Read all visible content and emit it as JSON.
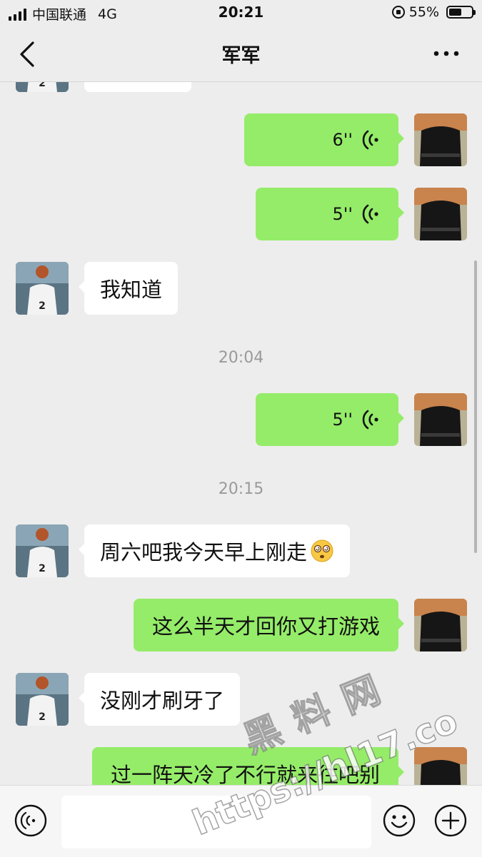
{
  "status_bar": {
    "carrier": "中国联通",
    "network": "4G",
    "time": "20:21",
    "battery_percent": "55%",
    "battery_level": 0.55
  },
  "header": {
    "title": "军军",
    "back_icon": "chevron-left-icon",
    "more_icon": "more-dots-icon"
  },
  "messages": [
    {
      "side": "in",
      "type": "text",
      "text": ""
    },
    {
      "side": "out",
      "type": "voice",
      "duration": "6''",
      "icon": "voice-wave-icon"
    },
    {
      "side": "out",
      "type": "voice",
      "duration": "5''",
      "icon": "voice-wave-icon"
    },
    {
      "side": "in",
      "type": "text",
      "text": "我知道"
    },
    {
      "type": "time",
      "text": "20:04"
    },
    {
      "side": "out",
      "type": "voice",
      "duration": "5''",
      "icon": "voice-wave-icon"
    },
    {
      "type": "time",
      "text": "20:15"
    },
    {
      "side": "in",
      "type": "text",
      "text": "周六吧我今天早上刚走",
      "emoji": "dizzy-face-emoji"
    },
    {
      "side": "out",
      "type": "text",
      "text": "这么半天才回你又打游戏"
    },
    {
      "side": "in",
      "type": "text",
      "text": "没刚才刷牙了"
    },
    {
      "side": "out",
      "type": "text",
      "text": "过一阵天冷了不行就来往吧别"
    }
  ],
  "input_bar": {
    "voice_icon": "voice-mode-icon",
    "emoji_icon": "smiley-icon",
    "plus_icon": "plus-circle-icon"
  },
  "watermark": {
    "line1": "黑 料 网",
    "line2": "https://hl17.co"
  },
  "colors": {
    "background": "#ededed",
    "outgoing_bubble": "#95ec69",
    "incoming_bubble": "#ffffff",
    "timestamp": "#9a9a9a"
  }
}
